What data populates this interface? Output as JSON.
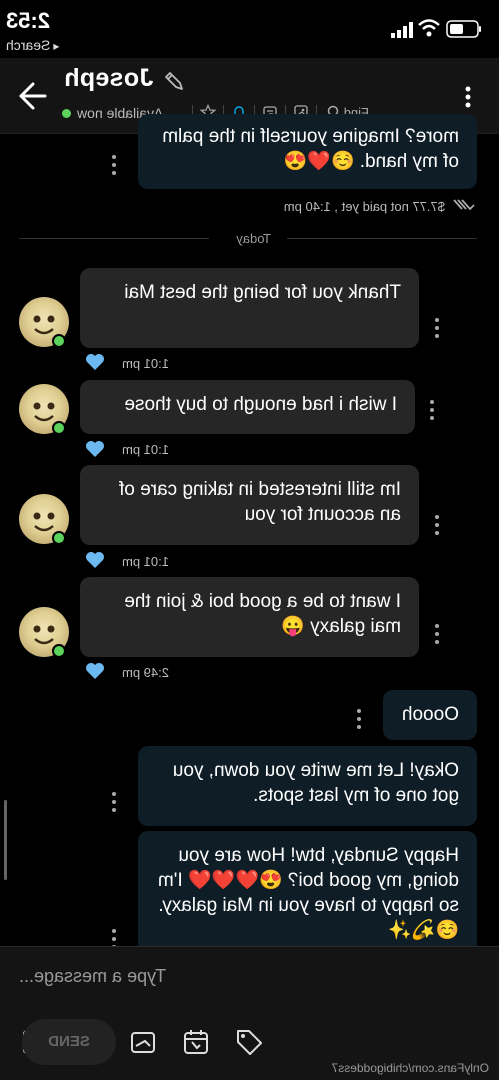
{
  "status_bar": {
    "time": "2:53",
    "back_app": "Search",
    "back_arrow": "◂"
  },
  "header": {
    "title": "Joseph",
    "status": "Available now",
    "find_label": "Find",
    "icons": [
      "back-arrow-icon",
      "pencil-icon",
      "star-icon",
      "bell-icon",
      "media-icon",
      "gallery-icon",
      "search-icon",
      "more-icon"
    ]
  },
  "messages": [
    {
      "id": "m0",
      "type": "out",
      "text": "more? Imagine yourself in the palm of my hand. ☺️❤️😍",
      "meta": "$7.77 not paid yet , 1:40 pm"
    },
    {
      "id": "m1",
      "type": "in",
      "text": "Thank you for being the best Mai",
      "time": "1:01 pm"
    },
    {
      "id": "m2",
      "type": "in",
      "text": "I wish i had enough to buy those",
      "time": "1:01 pm"
    },
    {
      "id": "m3",
      "type": "in",
      "text": "Im still interested in taking care of an account for you",
      "time": "1:01 pm"
    },
    {
      "id": "m4",
      "type": "in",
      "text": "I want to be a good boi & join the mai galaxy 😛",
      "time": "2:49 pm"
    },
    {
      "id": "m5",
      "type": "out",
      "text": "Ooooh"
    },
    {
      "id": "m6",
      "type": "out",
      "text": "Okay! Let me write you down, you got one of my last spots."
    },
    {
      "id": "m7",
      "type": "out",
      "text": "Happy Sunday, btw! How are you doing, my good boi? 😍❤️❤️❤️ I'm so happy to have you in Mai galaxy. ☺️💫✨"
    }
  ],
  "day_divider": "Today",
  "composer": {
    "placeholder": "Type a message...",
    "send_label": "SEND"
  },
  "watermark": "OnlyFans.com/chibigoddess7",
  "colors": {
    "accent": "#00aff0",
    "online": "#5cd35c",
    "heart": "#6cb8f0",
    "bubble_in": "#262626",
    "bubble_out": "#0f1d27"
  }
}
